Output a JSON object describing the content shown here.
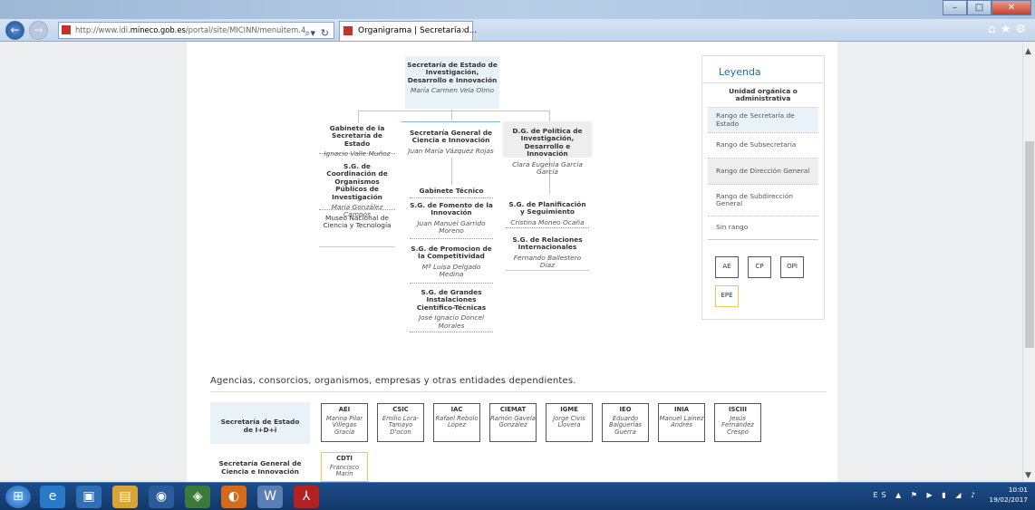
{
  "browser": {
    "url_prefix": "http://www.idi.",
    "url_domain": "mineco.gob.es",
    "url_suffix": "/portal/site/MICINN/menuitem.4.",
    "tab_title": "Organigrama | Secretaría d...",
    "tab_close": "×"
  },
  "org": {
    "top": {
      "title": "Secretaría de Estado de Investigación, Desarrollo e Innovación",
      "person": "María Carmen Vela Olmo"
    },
    "gabinete": {
      "title": "Gabinete de la Secretaría de Estado",
      "person": "Ignacio Valle Muñoz"
    },
    "sg_coord": {
      "title": "S.G. de Coordinación de Organismos Públicos de Investigación",
      "person": "María González Campos"
    },
    "museo": {
      "title": "Museo Nacional de Ciencia y Tecnología"
    },
    "sec_general": {
      "title": "Secretaría General de Ciencia e Innovación",
      "person": "Juan María Vázquez Rojas"
    },
    "gab_tecnico": {
      "title": "Gabinete Técnico"
    },
    "sg_fomento": {
      "title": "S.G. de Fomento de la Innovación",
      "person": "Juan Manuel Garrido Moreno"
    },
    "sg_promocion": {
      "title": "S.G. de Promocion de la Competitividad",
      "person": "Mª Luisa Delgado Medina"
    },
    "sg_grandes": {
      "title": "S.G. de Grandes Instalaciones Científico-Técnicas",
      "person": "José Ignacio Doncel Morales"
    },
    "dg_politica": {
      "title": "D.G. de Política de Investigación, Desarrollo e Innovación",
      "person": "Clara Eugenia García García"
    },
    "sg_planif": {
      "title": "S.G. de Planificación y Seguimiento",
      "person": "Cristina Moneo Ocaña"
    },
    "sg_rel": {
      "title": "S.G. de Relaciones Internacionales",
      "person": "Fernando Ballestero Díaz"
    }
  },
  "legend": {
    "title": "Leyenda",
    "items": [
      "Unidad orgánica o administrativa",
      "Rango de Secretaría de Estado",
      "Rango de Subsecretaría",
      "Rango de Dirección General",
      "Rango de Subdirección General",
      "Sin rango"
    ],
    "boxes": [
      "AE",
      "CP",
      "OPI",
      "EPE"
    ]
  },
  "agencies": {
    "section_title": "Agencias, consorcios, organismos, empresas y otras entidades dependientes.",
    "row1_label": "Secretaría de Estado de I+D+i",
    "row2_label": "Secretaría General de Ciencia e Innovación",
    "row1": [
      {
        "t": "AEI",
        "p": "Marina Pilar Villegas Gracia"
      },
      {
        "t": "CSIC",
        "p": "Emilio Lora-Tamayo D'ocon"
      },
      {
        "t": "IAC",
        "p": "Rafael Rebolo López"
      },
      {
        "t": "CIEMAT",
        "p": "Ramón Gavela González"
      },
      {
        "t": "IGME",
        "p": "Jorge Civis Llovera"
      },
      {
        "t": "IEO",
        "p": "Eduardo Balguerías Guerra"
      },
      {
        "t": "INIA",
        "p": "Manuel Laínez Andrés"
      },
      {
        "t": "ISCIII",
        "p": "Jesús Fernández Crespo"
      }
    ],
    "row2": [
      {
        "t": "CDTI",
        "p": "Francisco Marín"
      }
    ]
  },
  "tray": {
    "lang": "ES",
    "time": "10:01",
    "date": "19/02/2017"
  },
  "colors": {
    "accent": "#1b6fa8",
    "legend_epe": "#f2c94c",
    "legend_sec": "#e8f2f8",
    "legend_dg": "#eeeeee"
  }
}
